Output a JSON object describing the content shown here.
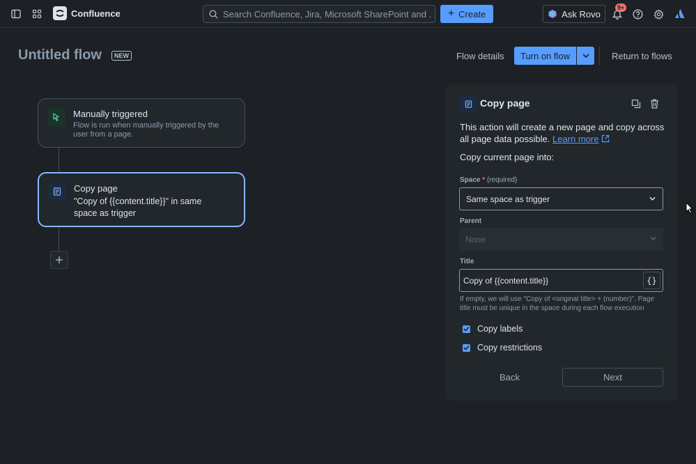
{
  "nav": {
    "app_name": "Confluence",
    "search_placeholder": "Search Confluence, Jira, Microsoft SharePoint and ...",
    "create_label": "Create",
    "ask_rovo_label": "Ask Rovo",
    "notification_count": "9+"
  },
  "page": {
    "title": "Untitled flow",
    "new_badge": "NEW",
    "flow_details": "Flow details",
    "turn_on_label": "Turn on flow",
    "return_label": "Return to flows"
  },
  "flow": {
    "trigger": {
      "title": "Manually triggered",
      "desc": "Flow is run when manually triggered by the user from a page."
    },
    "action": {
      "title": "Copy page",
      "desc": "\"Copy of {{content.title}}\" in same space as trigger"
    }
  },
  "panel": {
    "title": "Copy page",
    "desc": "This action will create a new page and copy across all page data possible.",
    "learn_more": "Learn more",
    "subhead": "Copy current page into:",
    "space_label": "Space",
    "space_required_marker": "*",
    "space_required_text": "(required)",
    "space_value": "Same space as trigger",
    "parent_label": "Parent",
    "parent_value": "None",
    "title_label": "Title",
    "title_value": "Copy of {{content.title}}",
    "var_button": "{}",
    "helper": "If empty, we will use \"Copy of <original title> + (number)\". Page title must be unique in the space during each flow execution",
    "copy_labels": "Copy labels",
    "copy_restrictions": "Copy restrictions",
    "back_label": "Back",
    "next_label": "Next"
  },
  "colors": {
    "background": "#1d2125",
    "surface": "#22272b",
    "accent": "#579dff",
    "trigger_icon": "#4bce97",
    "danger": "#f87168"
  }
}
